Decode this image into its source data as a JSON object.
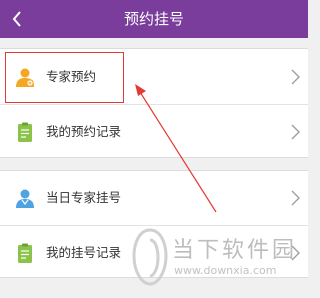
{
  "header": {
    "title": "预约挂号",
    "back_icon": "chevron-left-icon"
  },
  "groups": [
    {
      "items": [
        {
          "label": "专家预约",
          "icon": "expert-doctor-icon",
          "highlighted": true
        },
        {
          "label": "我的预约记录",
          "icon": "clipboard-icon"
        }
      ]
    },
    {
      "items": [
        {
          "label": "当日专家挂号",
          "icon": "doctor-icon"
        },
        {
          "label": "我的挂号记录",
          "icon": "clipboard-icon"
        }
      ]
    }
  ],
  "annotation": {
    "box_color": "#e53935",
    "arrow_color": "#e53935"
  },
  "watermark": {
    "brand": "当下软件园",
    "url": "www.downxia.com"
  },
  "colors": {
    "header": "#7a3d9c",
    "background": "#f0f0f0",
    "icon_orange": "#f5a623",
    "icon_green": "#8bc34a",
    "icon_blue": "#4fa3e0"
  }
}
